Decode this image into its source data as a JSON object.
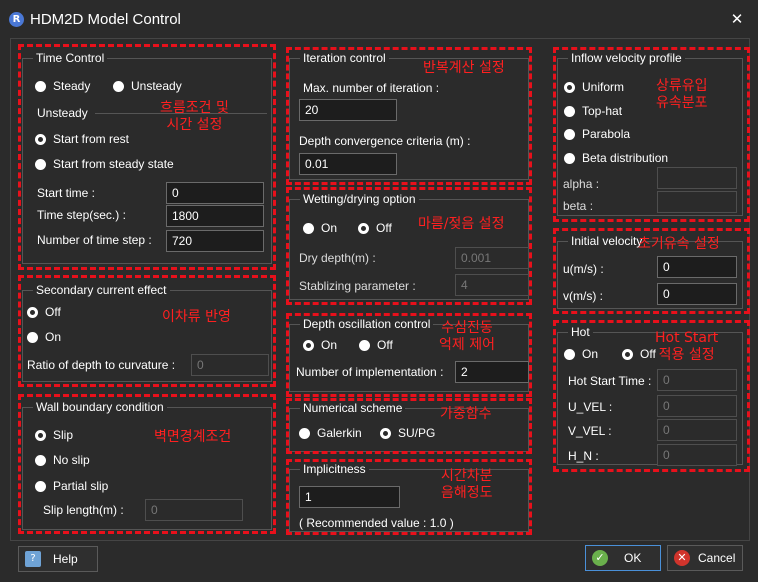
{
  "window": {
    "title": "HDM2D Model Control"
  },
  "icons": {
    "app": "R",
    "close": "✕",
    "ok": "✓",
    "cancel": "✕",
    "help": "?"
  },
  "time_control": {
    "title": "Time Control",
    "steady": "Steady",
    "unsteady": "Unsteady",
    "unsteady_group": "Unsteady",
    "start_rest": "Start from rest",
    "start_steady": "Start from steady state",
    "start_time_label": "Start time :",
    "start_time": "0",
    "time_step_label": "Time step(sec.) :",
    "time_step": "1800",
    "num_steps_label": "Number of time step :",
    "num_steps": "720",
    "annotation_1": "흐름조건 및",
    "annotation_2": "시간 설정"
  },
  "secondary": {
    "title": "Secondary current effect",
    "off": "Off",
    "on": "On",
    "ratio_label": "Ratio of depth to curvature :",
    "ratio": "0",
    "annotation": "이차류 반영"
  },
  "wall": {
    "title": "Wall boundary condition",
    "slip": "Slip",
    "no_slip": "No slip",
    "partial_slip": "Partial slip",
    "slip_length_label": "Slip length(m) :",
    "slip_length": "0",
    "annotation": "벽면경계조건"
  },
  "iteration": {
    "title": "Iteration control",
    "max_label": "Max. number of iteration :",
    "max": "20",
    "depth_label": "Depth convergence criteria (m) :",
    "depth": "0.01",
    "annotation": "반복계산 설정"
  },
  "wetting": {
    "title": "Wetting/drying option",
    "on": "On",
    "off": "Off",
    "dry_label": "Dry depth(m) :",
    "dry": "0.001",
    "stab_label": "Stablizing parameter :",
    "stab": "4",
    "annotation": "마름/젖음 설정"
  },
  "oscillation": {
    "title": "Depth oscillation control",
    "on": "On",
    "off": "Off",
    "impl_label": "Number of implementation :",
    "impl": "2",
    "annotation_1": "수심진동",
    "annotation_2": "억제 제어"
  },
  "numerical": {
    "title": "Numerical scheme",
    "galerkin": "Galerkin",
    "supg": "SU/PG",
    "annotation": "가중함수"
  },
  "implicitness": {
    "title": "Implicitness",
    "value": "1",
    "recommended": "( Recommended value : 1.0 )",
    "annotation_1": "시간차분",
    "annotation_2": "음해정도"
  },
  "inflow": {
    "title": "Inflow velocity profile",
    "uniform": "Uniform",
    "tophat": "Top-hat",
    "parabola": "Parabola",
    "beta": "Beta distribution",
    "alpha_label": "alpha :",
    "beta_label": "beta :",
    "annotation_1": "상류유입",
    "annotation_2": "유속분포"
  },
  "initial_velocity": {
    "title": "Initial velocity",
    "u_label": "u(m/s) :",
    "u": "0",
    "v_label": "v(m/s) :",
    "v": "0",
    "annotation": "초기유속 설정"
  },
  "hot": {
    "title": "Hot",
    "on": "On",
    "off": "Off",
    "time_label": "Hot Start Time :",
    "time": "0",
    "uvel_label": "U_VEL :",
    "uvel": "0",
    "vvel_label": "V_VEL :",
    "vvel": "0",
    "hn_label": "H_N :",
    "hn": "0",
    "annotation_1": "Hot Start",
    "annotation_2": "적용 설정"
  },
  "buttons": {
    "help": "Help",
    "ok": "OK",
    "cancel": "Cancel"
  },
  "colors": {
    "annotation": "#e8101b",
    "background": "#2b2b2b",
    "ok_icon": "#6ab04c",
    "cancel_icon": "#d0342c"
  }
}
